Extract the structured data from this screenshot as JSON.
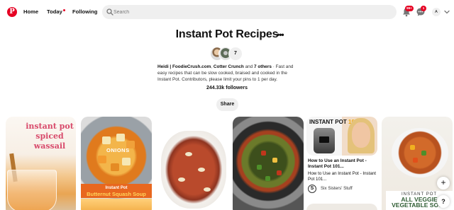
{
  "nav": {
    "logo_letter": "P",
    "home_label": "Home",
    "today_label": "Today",
    "following_label": "Following",
    "search_placeholder": "Search",
    "notifications_badge": "99+",
    "messages_badge": "1",
    "avatar_letter": "A"
  },
  "board": {
    "title": "Instant Pot Recipes",
    "more_label": "•••",
    "collaborators_count": "7",
    "description_names": "Heidi | FoodieCrush.com",
    "description_sep1": ", ",
    "description_name2": "Cotter Crunch",
    "description_and": " and ",
    "description_others": "7 others",
    "description_text": " · Fast and easy recipes that can be slow cooked, braised and cooked in the Instant Pot. Contributors, please limit your pins to 1 per day.",
    "followers": "244.33k followers",
    "share_label": "Share"
  },
  "pins": [
    {
      "title_lines": [
        "instant pot",
        "spiced",
        "wassail"
      ]
    },
    {
      "label": "ONIONS",
      "banner_top": "Instant Pot",
      "banner_bottom": "Butternut Squash Soup"
    },
    {},
    {},
    {
      "brand_prefix": "INSTANT POT ",
      "brand_suffix": "101",
      "title": "How to Use an Instant Pot - Instant Pot 101...",
      "subtitle": "How to Use an Instant Pot - Instant Pot 101...",
      "source_avatar": "S",
      "source_name": "Six Sisters' Stuff"
    },
    {
      "line1": "INSTANT POT",
      "line2": "ALL VEGGIE",
      "line3": "VEGETABLE SOUP"
    }
  ],
  "floating": {
    "plus_label": "+",
    "help_label": "?"
  },
  "colors": {
    "brand_red": "#e60023",
    "surface_grey": "#efefef"
  },
  "icons": [
    "pinterest-logo-icon",
    "search-icon",
    "bell-icon",
    "message-icon",
    "chevron-down-icon",
    "ellipsis-icon",
    "plus-icon",
    "help-icon"
  ]
}
